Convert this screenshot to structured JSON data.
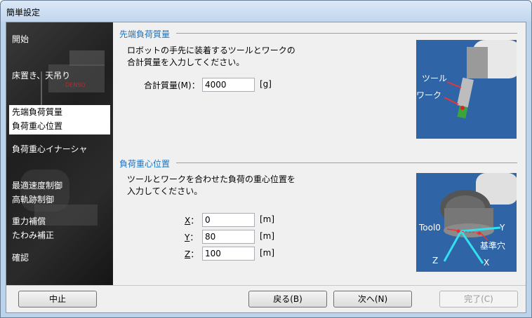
{
  "window": {
    "title": "簡単設定"
  },
  "sidebar": {
    "items": [
      {
        "label": "開始",
        "active": false
      },
      {
        "label": "床置き、天吊り",
        "active": false
      },
      {
        "label": "先端負荷質量\n負荷重心位置",
        "active": true
      },
      {
        "label": "負荷重心イナーシャ",
        "active": false
      },
      {
        "label": "最適速度制御\n高軌跡制御",
        "active": false
      },
      {
        "label": "重力補償\nたわみ補正",
        "active": false
      },
      {
        "label": "確認",
        "active": false
      }
    ]
  },
  "mass_section": {
    "title": "先端負荷質量",
    "desc1": "ロボットの手先に装着するツールとワークの",
    "desc2": "合計質量を入力してください。",
    "label": "合計質量(M)：",
    "value": "4000",
    "unit": "[g]",
    "img_tool": "ツール",
    "img_work": "ワーク"
  },
  "cog_section": {
    "title": "負荷重心位置",
    "desc1": "ツールとワークを合わせた負荷の重心位置を",
    "desc2": "入力してください。",
    "x_label": "X",
    "y_label": "Y",
    "z_label": "Z",
    "colon": "：",
    "x_value": "0",
    "y_value": "80",
    "z_value": "100",
    "unit": "[m]",
    "img_tool0": "Tool0",
    "img_y": "Y",
    "img_kijun": "基準穴",
    "img_z": "Z",
    "img_x": "X"
  },
  "buttons": {
    "cancel": "中止",
    "back": "戻る(B)",
    "next": "次へ(N)",
    "finish": "完了(C)"
  },
  "colors": {
    "accent": "#1e73be",
    "preview_bg": "#2f65a7"
  }
}
